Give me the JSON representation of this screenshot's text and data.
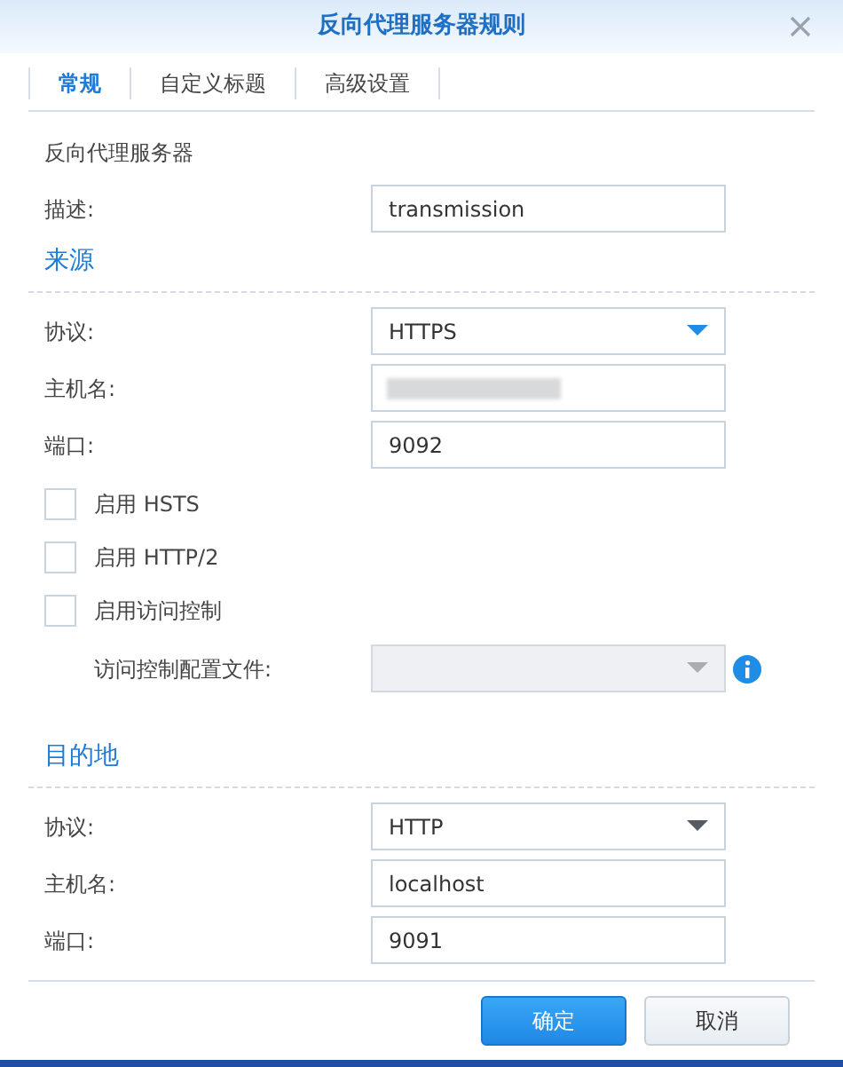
{
  "window": {
    "title": "反向代理服务器规则"
  },
  "tabs": [
    {
      "label": "常规",
      "selected": true
    },
    {
      "label": "自定义标题",
      "selected": false
    },
    {
      "label": "高级设置",
      "selected": false
    }
  ],
  "general": {
    "heading": "反向代理服务器",
    "fields": [
      {
        "kind": "text",
        "label": "描述:",
        "value": "transmission"
      }
    ]
  },
  "source": {
    "heading": "来源",
    "fields": [
      {
        "kind": "select",
        "label": "协议:",
        "value": "HTTPS",
        "disabled": false,
        "focused": true
      },
      {
        "kind": "blurred",
        "label": "主机名:"
      },
      {
        "kind": "text",
        "label": "端口:",
        "value": "9092"
      }
    ],
    "checkboxes": [
      {
        "label": "启用 HSTS",
        "checked": false
      },
      {
        "label": "启用 HTTP/2",
        "checked": false
      },
      {
        "label": "启用访问控制",
        "checked": false
      }
    ],
    "sub_fields": [
      {
        "kind": "select",
        "label": "访问控制配置文件:",
        "disabled": true,
        "info": true
      }
    ]
  },
  "destination": {
    "heading": "目的地",
    "fields": [
      {
        "kind": "select",
        "label": "协议:",
        "value": "HTTP",
        "disabled": false,
        "focused": false
      },
      {
        "kind": "text",
        "label": "主机名:",
        "value": "localhost"
      },
      {
        "kind": "text",
        "label": "端口:",
        "value": "9091"
      }
    ]
  },
  "buttons": [
    {
      "kind": "primary",
      "label": "确定"
    },
    {
      "kind": "secondary",
      "label": "取消"
    }
  ]
}
